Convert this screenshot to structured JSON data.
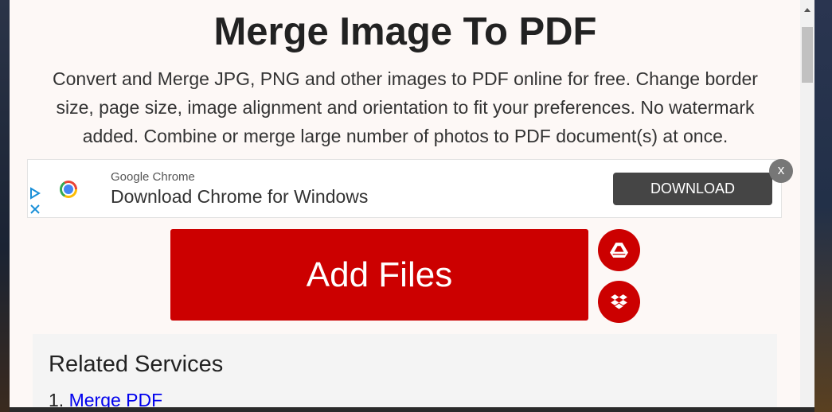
{
  "page": {
    "title": "Merge Image To PDF",
    "description": "Convert and Merge JPG, PNG and other images to PDF online for free. Change border size, page size, image alignment and orientation to fit your preferences. No watermark added. Combine or merge large number of photos to PDF document(s) at once."
  },
  "ad": {
    "brand": "Google Chrome",
    "headline": "Download Chrome for Windows",
    "cta": "DOWNLOAD",
    "close": "x",
    "info_icon": "ad-choices-icon"
  },
  "upload": {
    "add_files_label": "Add Files",
    "google_drive_icon": "google-drive-icon",
    "dropbox_icon": "dropbox-icon"
  },
  "related": {
    "title": "Related Services",
    "items": [
      {
        "number": "1.",
        "label": "Merge PDF"
      }
    ]
  },
  "colors": {
    "accent": "#cc0000",
    "ad_button": "#454545",
    "link": "#0000ee"
  }
}
